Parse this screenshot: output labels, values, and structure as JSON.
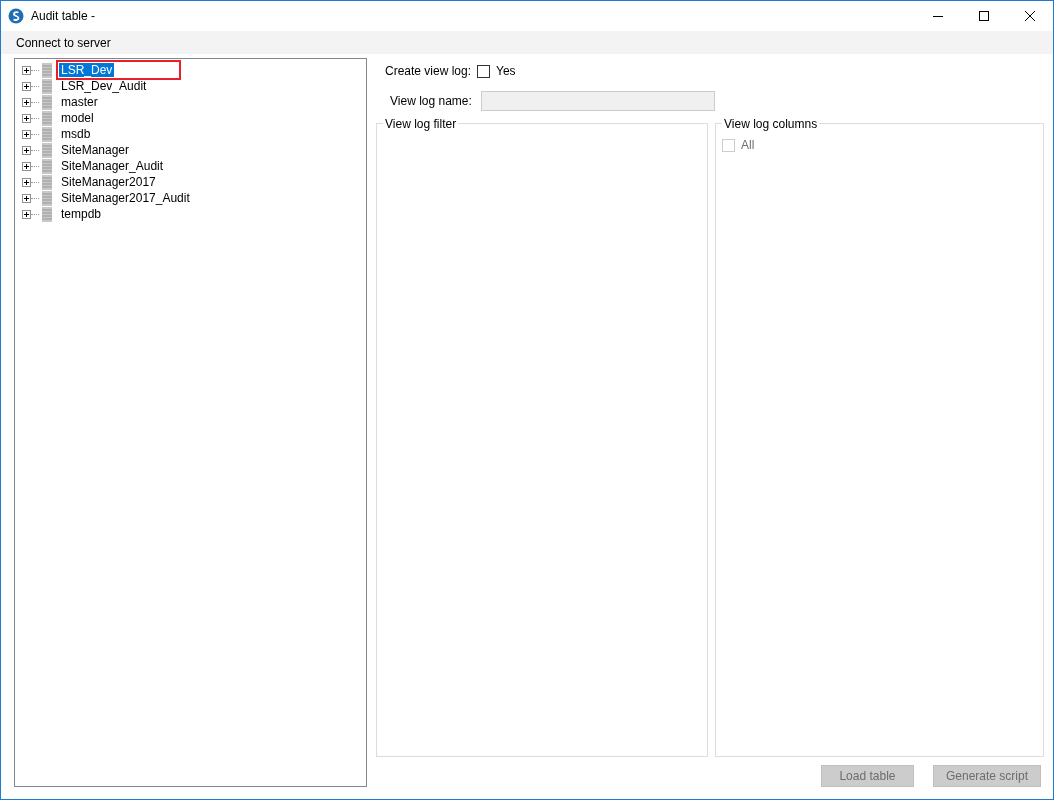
{
  "window": {
    "title": "Audit table -"
  },
  "menu": [
    {
      "label": "Connect to server"
    }
  ],
  "tree": {
    "items": [
      {
        "label": "LSR_Dev",
        "selected": true,
        "highlighted": true,
        "expanded": false
      },
      {
        "label": "LSR_Dev_Audit",
        "selected": false,
        "highlighted": false,
        "expanded": false
      },
      {
        "label": "master",
        "selected": false,
        "highlighted": false,
        "expanded": false
      },
      {
        "label": "model",
        "selected": false,
        "highlighted": false,
        "expanded": false
      },
      {
        "label": "msdb",
        "selected": false,
        "highlighted": false,
        "expanded": false
      },
      {
        "label": "SiteManager",
        "selected": false,
        "highlighted": false,
        "expanded": false
      },
      {
        "label": "SiteManager_Audit",
        "selected": false,
        "highlighted": false,
        "expanded": false
      },
      {
        "label": "SiteManager2017",
        "selected": false,
        "highlighted": false,
        "expanded": false
      },
      {
        "label": "SiteManager2017_Audit",
        "selected": false,
        "highlighted": false,
        "expanded": false
      },
      {
        "label": "tempdb",
        "selected": false,
        "highlighted": false,
        "expanded": false
      }
    ]
  },
  "create_view_log": {
    "label": "Create view log:",
    "option": "Yes",
    "checked": false
  },
  "view_log_name": {
    "label": "View log name:",
    "disabled": true
  },
  "filter_group": {
    "title": "View log filter"
  },
  "columns_group": {
    "title": "View log columns",
    "items": [
      {
        "label": "All",
        "checked": false,
        "disabled": true
      }
    ]
  },
  "buttons": [
    {
      "label": "Load table",
      "disabled": true
    },
    {
      "label": "Generate script",
      "disabled": true
    }
  ]
}
